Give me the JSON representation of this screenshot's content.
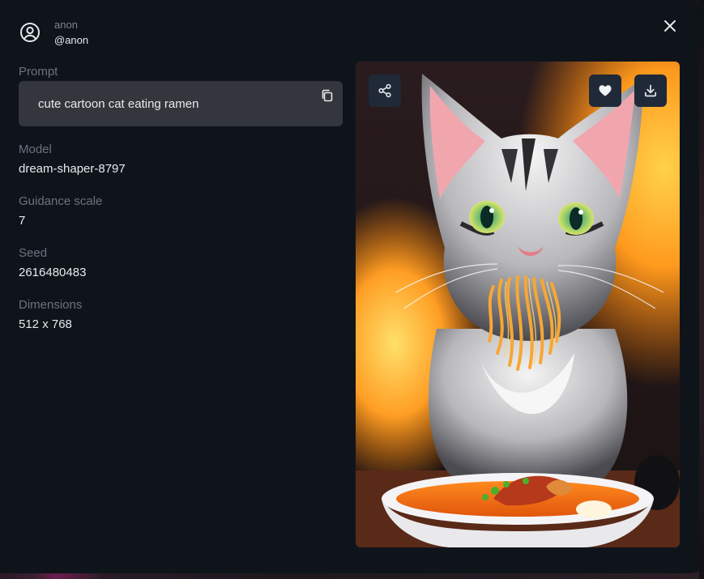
{
  "user": {
    "name": "anon",
    "handle": "@anon",
    "avatar_icon": "user-circle-icon"
  },
  "actions": {
    "close_icon": "close-icon",
    "copy_icon": "copy-icon",
    "share_icon": "share-icon",
    "like_icon": "heart-icon",
    "download_icon": "download-icon"
  },
  "details": {
    "prompt_label": "Prompt",
    "prompt": "cute cartoon cat eating ramen",
    "model_label": "Model",
    "model": "dream-shaper-8797",
    "guidance_label": "Guidance scale",
    "guidance": "7",
    "seed_label": "Seed",
    "seed": "2616480483",
    "dimensions_label": "Dimensions",
    "dimensions": "512 x 768"
  },
  "colors": {
    "modal_bg": "#0f141b",
    "prompt_bg": "#34363d",
    "button_bg": "#1f2937",
    "label": "#6b7380",
    "text": "#e8eaed"
  }
}
